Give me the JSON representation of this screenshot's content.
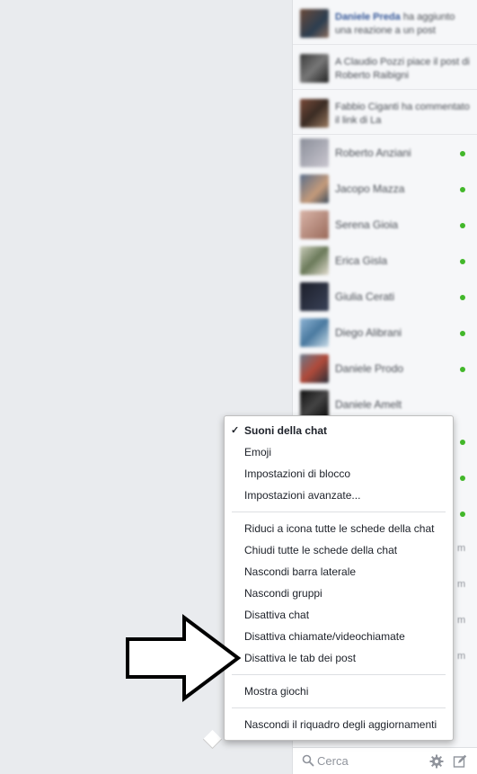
{
  "ticker": [
    {
      "name": "Daniele Preda",
      "text": " ha aggiunto una reazione a un post"
    },
    {
      "name": "Claudio Pozzi",
      "text": "A Claudio Pozzi piace il post di Roberto Raibigni"
    },
    {
      "name": "Fabbio Ciganti",
      "text": "Fabbio Ciganti ha commentato il link di La"
    }
  ],
  "contacts": [
    {
      "name": "Roberto Anziani"
    },
    {
      "name": "Jacopo Mazza"
    },
    {
      "name": "Serena Gioia"
    },
    {
      "name": "Erica Gisla"
    },
    {
      "name": "Giulia Cerati"
    },
    {
      "name": "Diego Alibrani"
    },
    {
      "name": "Daniele Prodo"
    },
    {
      "name": "Daniele Amelt"
    }
  ],
  "time_labels": [
    "m",
    "m",
    "m",
    "m"
  ],
  "search": {
    "placeholder": "Cerca"
  },
  "menu": {
    "items": [
      {
        "label": "Suoni della chat",
        "checked": true
      },
      {
        "label": "Emoji"
      },
      {
        "label": "Impostazioni di blocco"
      },
      {
        "label": "Impostazioni avanzate..."
      },
      {
        "label": "Riduci a icona tutte le schede della chat"
      },
      {
        "label": "Chiudi tutte le schede della chat"
      },
      {
        "label": "Nascondi barra laterale"
      },
      {
        "label": "Nascondi gruppi"
      },
      {
        "label": "Disattiva chat"
      },
      {
        "label": "Disattiva chiamate/videochiamate"
      },
      {
        "label": "Disattiva le tab dei post"
      },
      {
        "label": "Mostra giochi"
      },
      {
        "label": "Nascondi il riquadro degli aggiornamenti"
      }
    ],
    "check_mark": "✓"
  },
  "colors": {
    "online": "#42b72a",
    "link": "#365899",
    "background": "#e9ebee"
  }
}
